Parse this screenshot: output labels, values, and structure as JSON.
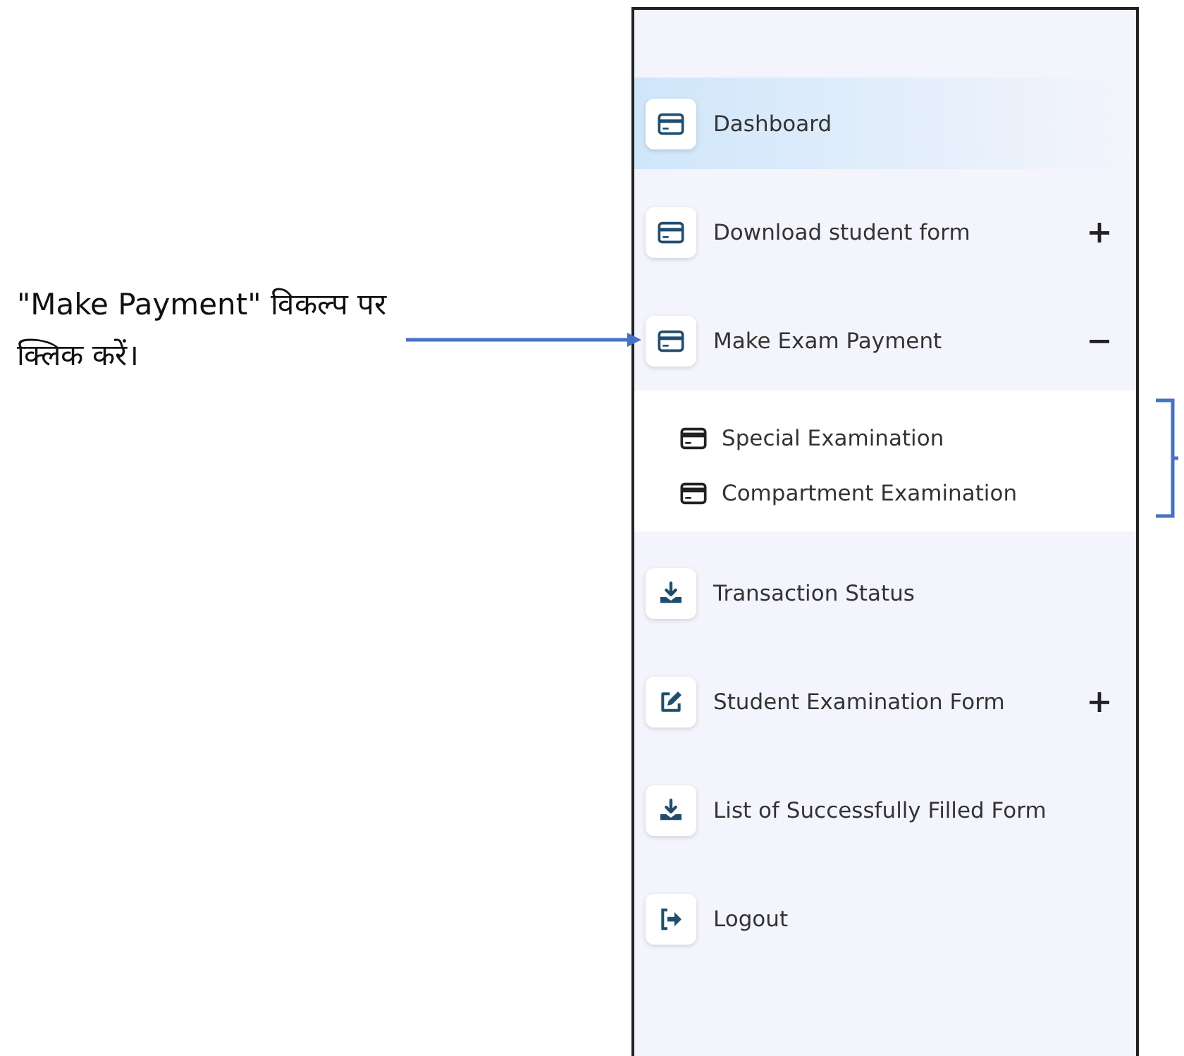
{
  "annotation": {
    "text": "\"Make Payment\" विकल्प पर क्लिक करें।"
  },
  "sidebar": {
    "items": [
      {
        "label": "Dashboard",
        "selected": true
      },
      {
        "label": "Download student form",
        "selected": false,
        "expanded": false
      },
      {
        "label": "Make Exam Payment",
        "selected": false,
        "expanded": true,
        "children": [
          {
            "label": "Special Examination"
          },
          {
            "label": "Compartment Examination"
          }
        ]
      },
      {
        "label": "Transaction Status",
        "selected": false
      },
      {
        "label": "Student Examination Form",
        "selected": false,
        "expanded": false
      },
      {
        "label": "List of Successfully Filled Form",
        "selected": false
      },
      {
        "label": "Logout",
        "selected": false
      }
    ]
  }
}
